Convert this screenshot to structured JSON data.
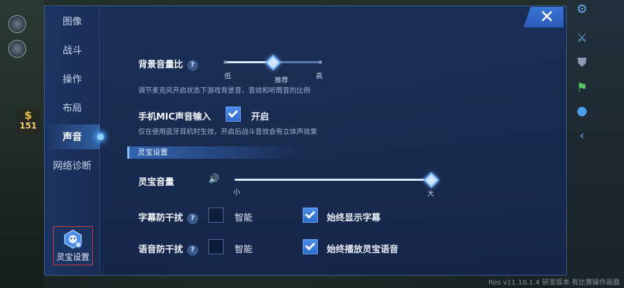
{
  "nav": {
    "items": [
      "图像",
      "战斗",
      "操作",
      "布局",
      "声音",
      "网络诊断"
    ],
    "active_index": 4,
    "pet_settings": "灵宝设置"
  },
  "background": {
    "gold": "151",
    "version": "Res v11.10.1.4 研发版本 有比赛操作画面"
  },
  "close_icon": "close-x",
  "settings": {
    "bg_volume": {
      "label": "背景音量比",
      "hint": "调节麦克风开启状态下游戏背景音、音效和听筒音的比例",
      "ticks": [
        "低",
        "推荐",
        "高"
      ],
      "value_fraction": 0.5
    },
    "mic_input": {
      "label": "手机MIC声音输入",
      "option": "开启",
      "checked": true,
      "hint": "仅在使用蓝牙耳机时生效，开启后战斗音效会有立体声效果"
    },
    "section_title": "灵宝设置",
    "pet_volume": {
      "label": "灵宝音量",
      "min_label": "小",
      "max_label": "大",
      "value_fraction": 1.0
    },
    "subtitle_interference": {
      "label": "字幕防干扰",
      "smart": "智能",
      "smart_checked": false,
      "always": "始终显示字幕",
      "always_checked": true
    },
    "voice_interference": {
      "label": "语音防干扰",
      "smart": "智能",
      "smart_checked": false,
      "always": "始终播放灵宝语音",
      "always_checked": true
    }
  },
  "colors": {
    "panel": "#1a2e58",
    "accent": "#3a76d8",
    "highlight_border": "#d23a3a"
  }
}
